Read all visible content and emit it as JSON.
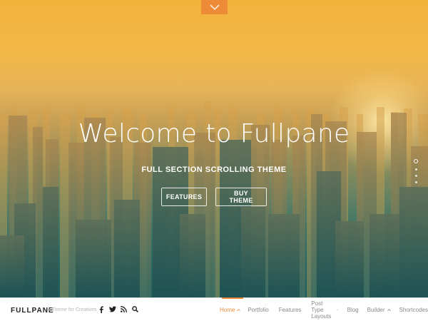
{
  "hero": {
    "title": "Welcome to Fullpane",
    "subtitle": "FULL SECTION SCROLLING THEME",
    "buttons": {
      "features": "FEATURES",
      "buy": "BUY THEME"
    }
  },
  "section_nav": {
    "dot_count": 4,
    "active_index": 0
  },
  "footer": {
    "brand": "FULLPANE",
    "tagline": "A Theme for Creatives",
    "social": [
      "facebook-icon",
      "twitter-icon",
      "rss-icon",
      "search-icon"
    ],
    "menu": {
      "home": "Home",
      "portfolio": "Portfolio",
      "features": "Features",
      "post_type_layouts": "Post Type Layouts",
      "blog": "Blog",
      "builder": "Builder",
      "shortcodes": "Shortcodes"
    }
  },
  "colors": {
    "accent": "#ee8b38",
    "sky_top": "#f3b33b",
    "city_bottom": "#1f5d5c"
  }
}
